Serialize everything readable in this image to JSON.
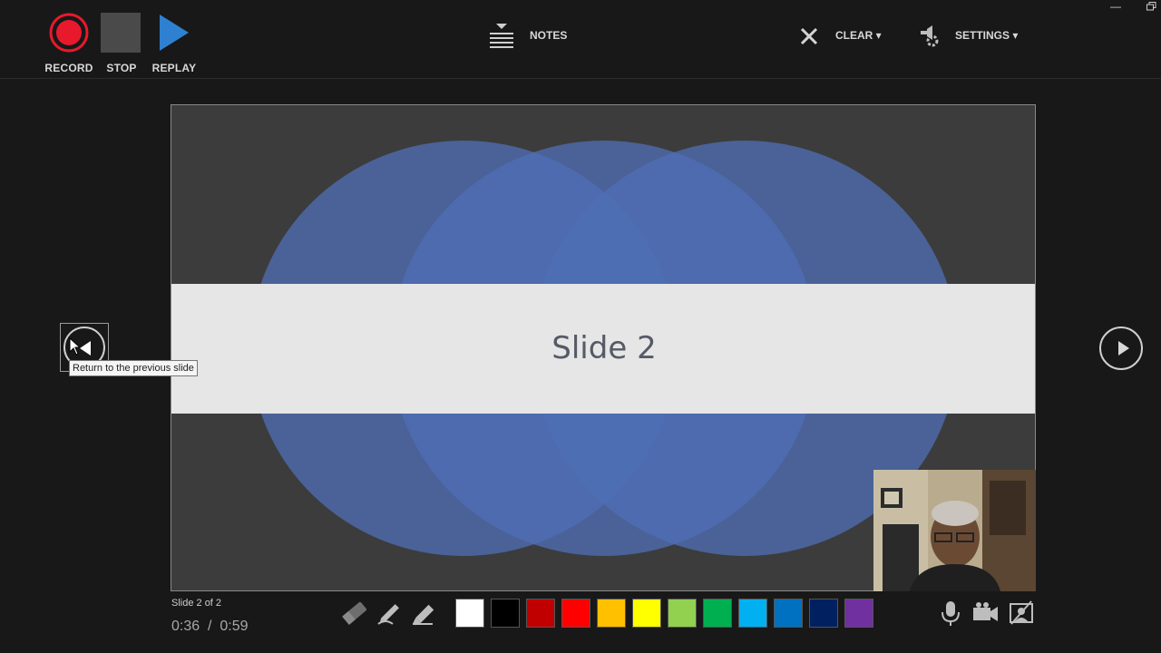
{
  "toolbar": {
    "record_label": "RECORD",
    "stop_label": "STOP",
    "replay_label": "REPLAY",
    "notes_label": "NOTES",
    "clear_label": "CLEAR ▾",
    "settings_label": "SETTINGS ▾"
  },
  "slide": {
    "title": "Slide 2"
  },
  "nav": {
    "prev_tooltip": "Return to the previous slide"
  },
  "status": {
    "slide_count": "Slide 2 of 2",
    "time": "0:36  /  0:59"
  },
  "colors": {
    "record": "#e8192c",
    "stop": "#4a4a4a",
    "replay": "#2f80d1",
    "circle": "#4f6fb5",
    "band": "#e6e6e6",
    "swatches": [
      "#ffffff",
      "#000000",
      "#c00000",
      "#ff0000",
      "#ffc000",
      "#ffff00",
      "#92d050",
      "#00b050",
      "#00b0f0",
      "#0070c0",
      "#002060",
      "#7030a0"
    ]
  },
  "icons": {
    "tools": [
      "eraser-icon",
      "pen-icon",
      "highlighter-icon"
    ],
    "media": [
      "microphone-icon",
      "camera-icon",
      "camera-preview-icon"
    ]
  }
}
